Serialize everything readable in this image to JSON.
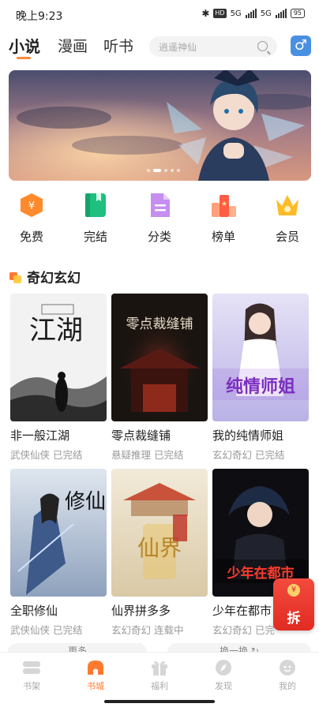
{
  "status": {
    "time": "晚上9:23",
    "hd": "HD",
    "signal1": "5G",
    "signal2": "5G",
    "battery": "95"
  },
  "tabs": [
    {
      "label": "小说",
      "active": true
    },
    {
      "label": "漫画",
      "active": false
    },
    {
      "label": "听书",
      "active": false
    }
  ],
  "search": {
    "placeholder": "逍遥神仙"
  },
  "gender_icon": "male-icon",
  "banner": {
    "slides": 5,
    "active_index": 1
  },
  "categories": [
    {
      "label": "免费",
      "icon": "free-coin-icon",
      "color": "#ff8a2c"
    },
    {
      "label": "完结",
      "icon": "book-icon",
      "color": "#1fbf7f"
    },
    {
      "label": "分类",
      "icon": "document-icon",
      "color": "#b97be8"
    },
    {
      "label": "榜单",
      "icon": "ranking-icon",
      "color": "#ff6b4a"
    },
    {
      "label": "会员",
      "icon": "crown-icon",
      "color": "#ffb020"
    }
  ],
  "section": {
    "title": "奇幻玄幻"
  },
  "books": [
    {
      "title": "非一般江湖",
      "meta": "武侠仙侠 已完结",
      "cover_text": "江湖"
    },
    {
      "title": "零点裁缝铺",
      "meta": "悬疑推理 已完结",
      "cover_text": "零点裁缝铺"
    },
    {
      "title": "我的纯情师姐",
      "meta": "玄幻奇幻 已完结",
      "cover_text": "纯情师姐"
    },
    {
      "title": "全职修仙",
      "meta": "武侠仙侠 已完结",
      "cover_text": "修仙"
    },
    {
      "title": "仙界拼多多",
      "meta": "玄幻奇幻 连载中",
      "cover_text": "仙界"
    },
    {
      "title": "少年在都市",
      "meta": "玄幻奇幻 已完",
      "cover_text": "少年在都市"
    }
  ],
  "redpacket": {
    "label": "拆"
  },
  "hints": {
    "more": "更多",
    "refresh": "换一换 ↻"
  },
  "bottom_nav": [
    {
      "label": "书架",
      "icon": "bookshelf-icon",
      "active": false
    },
    {
      "label": "书城",
      "icon": "bookstore-icon",
      "active": true
    },
    {
      "label": "福利",
      "icon": "gift-icon",
      "active": false
    },
    {
      "label": "发现",
      "icon": "compass-icon",
      "active": false
    },
    {
      "label": "我的",
      "icon": "profile-icon",
      "active": false
    }
  ]
}
